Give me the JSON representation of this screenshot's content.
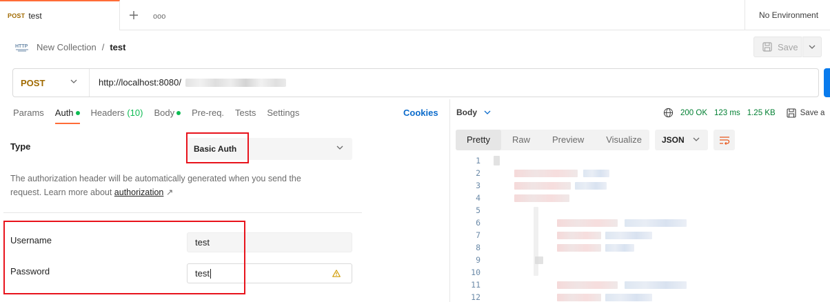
{
  "tabbar": {
    "active_tab": {
      "method": "POST",
      "name": "test"
    },
    "env_label": "No Environment"
  },
  "breadcrumb": {
    "collection": "New Collection",
    "separator": "/",
    "current": "test"
  },
  "toolbar": {
    "save_label": "Save"
  },
  "request": {
    "method": "POST",
    "url": "http://localhost:8080/"
  },
  "req_tabs": [
    {
      "label": "Params"
    },
    {
      "label": "Auth",
      "dot": true,
      "active": true
    },
    {
      "label": "Headers",
      "count": "(10)"
    },
    {
      "label": "Body",
      "dot": true
    },
    {
      "label": "Pre-req."
    },
    {
      "label": "Tests"
    },
    {
      "label": "Settings"
    }
  ],
  "cookies_label": "Cookies",
  "auth": {
    "type_label": "Type",
    "type_value": "Basic Auth",
    "description": "The authorization header will be automatically generated when you send the request. Learn more about ",
    "link_text": "authorization",
    "link_arrow": "↗",
    "username_label": "Username",
    "username_value": "test",
    "password_label": "Password",
    "password_value": "test"
  },
  "response": {
    "body_label": "Body",
    "status": "200 OK",
    "time": "123 ms",
    "size": "1.25 KB",
    "save_label": "Save a",
    "view_tabs": [
      "Pretty",
      "Raw",
      "Preview",
      "Visualize"
    ],
    "active_view": "Pretty",
    "format": "JSON",
    "line_numbers": [
      "1",
      "2",
      "3",
      "4",
      "5",
      "6",
      "7",
      "8",
      "9",
      "10",
      "11",
      "12"
    ]
  },
  "colors": {
    "accent": "#ff6c37",
    "method_post": "#a06a00",
    "success": "#007f31",
    "highlight": "#e8121b",
    "link": "#0b6bcb"
  }
}
